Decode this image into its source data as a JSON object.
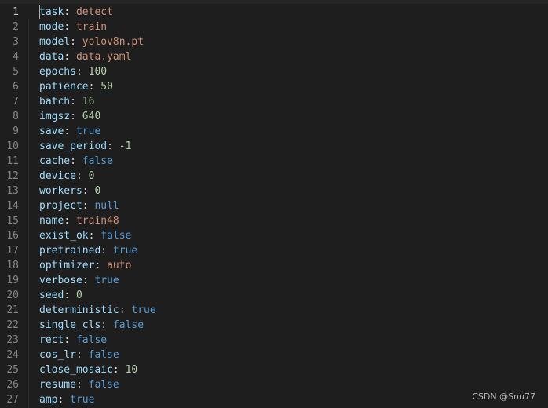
{
  "editor": {
    "top_crumb": "",
    "lines": [
      {
        "n": "1",
        "key": "task",
        "value": "detect",
        "type": "str"
      },
      {
        "n": "2",
        "key": "mode",
        "value": "train",
        "type": "str"
      },
      {
        "n": "3",
        "key": "model",
        "value": "yolov8n.pt",
        "type": "str"
      },
      {
        "n": "4",
        "key": "data",
        "value": "data.yaml",
        "type": "str"
      },
      {
        "n": "5",
        "key": "epochs",
        "value": "100",
        "type": "num"
      },
      {
        "n": "6",
        "key": "patience",
        "value": "50",
        "type": "num"
      },
      {
        "n": "7",
        "key": "batch",
        "value": "16",
        "type": "num"
      },
      {
        "n": "8",
        "key": "imgsz",
        "value": "640",
        "type": "num"
      },
      {
        "n": "9",
        "key": "save",
        "value": "true",
        "type": "bool"
      },
      {
        "n": "10",
        "key": "save_period",
        "value": "-1",
        "type": "num"
      },
      {
        "n": "11",
        "key": "cache",
        "value": "false",
        "type": "bool"
      },
      {
        "n": "12",
        "key": "device",
        "value": "0",
        "type": "num"
      },
      {
        "n": "13",
        "key": "workers",
        "value": "0",
        "type": "num"
      },
      {
        "n": "14",
        "key": "project",
        "value": "null",
        "type": "bool"
      },
      {
        "n": "15",
        "key": "name",
        "value": "train48",
        "type": "str"
      },
      {
        "n": "16",
        "key": "exist_ok",
        "value": "false",
        "type": "bool"
      },
      {
        "n": "17",
        "key": "pretrained",
        "value": "true",
        "type": "bool"
      },
      {
        "n": "18",
        "key": "optimizer",
        "value": "auto",
        "type": "str"
      },
      {
        "n": "19",
        "key": "verbose",
        "value": "true",
        "type": "bool"
      },
      {
        "n": "20",
        "key": "seed",
        "value": "0",
        "type": "num"
      },
      {
        "n": "21",
        "key": "deterministic",
        "value": "true",
        "type": "bool"
      },
      {
        "n": "22",
        "key": "single_cls",
        "value": "false",
        "type": "bool"
      },
      {
        "n": "23",
        "key": "rect",
        "value": "false",
        "type": "bool"
      },
      {
        "n": "24",
        "key": "cos_lr",
        "value": "false",
        "type": "bool"
      },
      {
        "n": "25",
        "key": "close_mosaic",
        "value": "10",
        "type": "num"
      },
      {
        "n": "26",
        "key": "resume",
        "value": "false",
        "type": "bool"
      },
      {
        "n": "27",
        "key": "amp",
        "value": "true",
        "type": "bool"
      }
    ],
    "current_line": 0
  },
  "watermark": "CSDN @Snu77",
  "colors": {
    "background": "#1e1e1e",
    "line_number": "#858585",
    "key": "#9cdcfe",
    "string": "#ce9178",
    "number": "#b5cea8",
    "keyword": "#569cd6"
  }
}
